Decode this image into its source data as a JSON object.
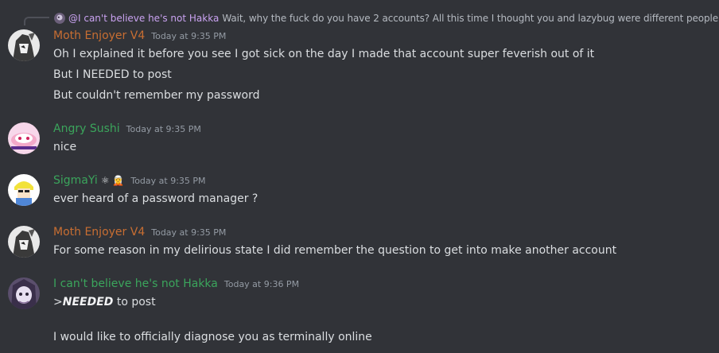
{
  "reply": {
    "mention": "@I can't believe he's not Hakka",
    "text": "Wait, why the fuck do you have 2 accounts? All this time I thought you and lazybug were different people"
  },
  "messages": [
    {
      "author": "Moth Enjoyer V4",
      "author_color": "#c86e32",
      "timestamp": "Today at 9:35 PM",
      "lines": [
        "Oh I explained it before you see I got sick on the day I made that account super feverish out of it",
        "But I NEEDED to post",
        "But couldn't remember my password"
      ]
    },
    {
      "author": "Angry Sushi",
      "author_color": "#3ba55c",
      "timestamp": "Today at 9:35 PM",
      "lines": [
        "nice"
      ]
    },
    {
      "author": "SigmaYi",
      "author_color": "#3ba55c",
      "badges": "⚛ 🧝",
      "timestamp": "Today at 9:35 PM",
      "lines": [
        "ever heard of a password manager ?"
      ]
    },
    {
      "author": "Moth Enjoyer V4",
      "author_color": "#c86e32",
      "timestamp": "Today at 9:35 PM",
      "lines": [
        "For some reason in my delirious state I did remember the question to get into make another account"
      ]
    },
    {
      "author": "I can't believe he's not Hakka",
      "author_color": "#3ba55c",
      "timestamp": "Today at 9:36 PM",
      "quote_prefix": ">",
      "quote_bold": "NEEDED",
      "quote_rest": " to post",
      "lines": [
        "I would like to officially diagnose you as terminally online"
      ]
    }
  ]
}
